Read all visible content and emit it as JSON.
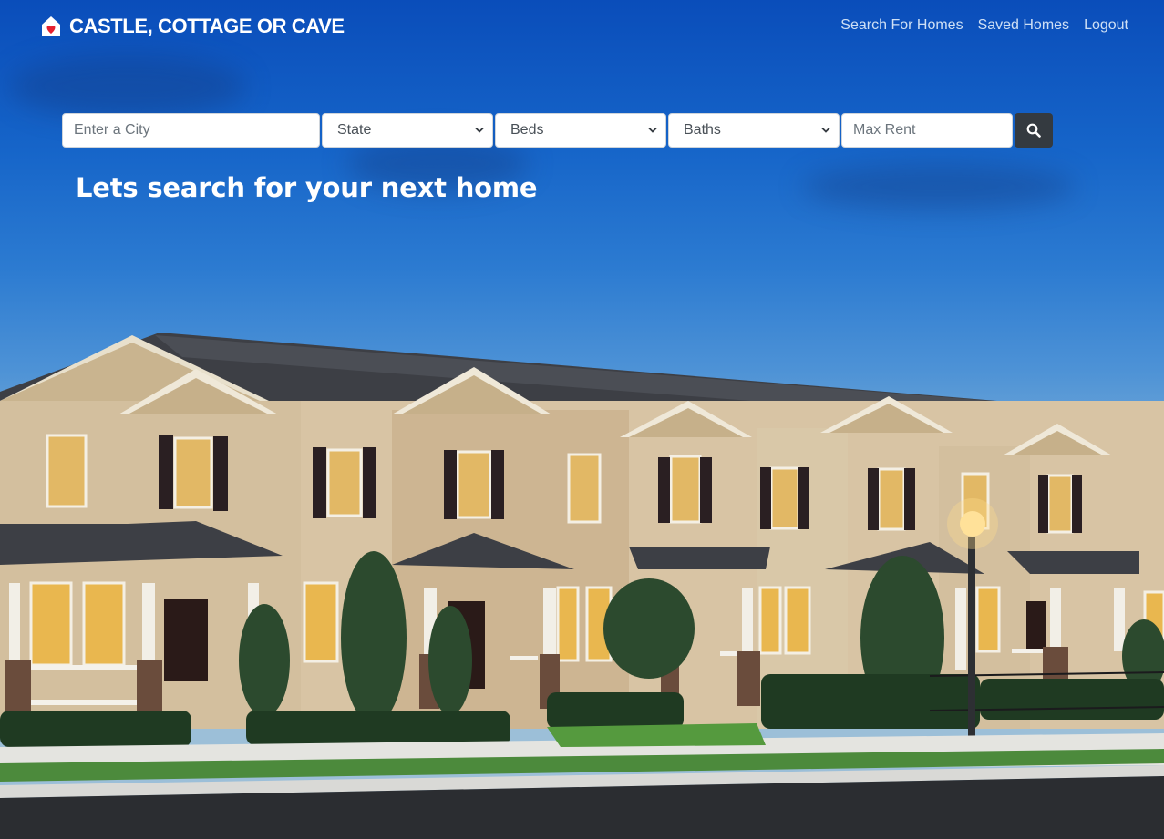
{
  "brand": {
    "name": "CASTLE, COTTAGE OR CAVE",
    "icon": "house-heart-icon",
    "icon_color": "#e4202f"
  },
  "nav": {
    "search_for_homes": "Search For Homes",
    "saved_homes": "Saved Homes",
    "logout": "Logout"
  },
  "search": {
    "city_placeholder": "Enter a City",
    "state_label": "State",
    "beds_label": "Beds",
    "baths_label": "Baths",
    "max_rent_placeholder": "Max Rent",
    "button_icon": "search-icon"
  },
  "hero": {
    "title": "Lets search for your next home"
  },
  "colors": {
    "nav_link": "#cfe0f5",
    "button_bg": "#343a40",
    "sky_top": "#0a4dba"
  }
}
